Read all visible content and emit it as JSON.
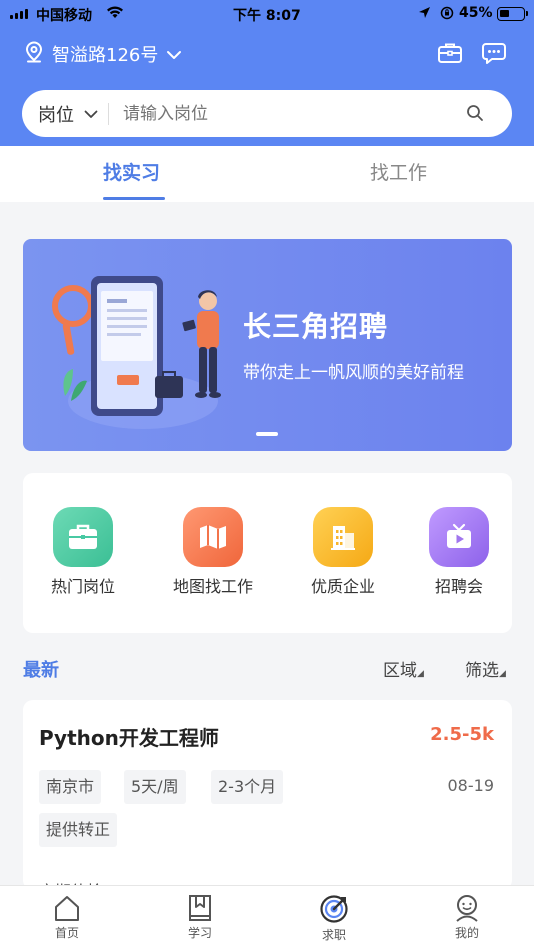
{
  "status_bar": {
    "carrier": "中国移动",
    "time": "下午 8:07",
    "battery_text": "45%",
    "battery_level": 0.45
  },
  "header": {
    "location": "智溢路126号",
    "icons": [
      "location-pin-icon",
      "chevron-down-icon",
      "briefcase-icon",
      "message-icon"
    ]
  },
  "search": {
    "category": "岗位",
    "placeholder": "请输入岗位"
  },
  "tabs": [
    {
      "label": "找实习",
      "active": true
    },
    {
      "label": "找工作",
      "active": false
    }
  ],
  "banner": {
    "title": "长三角招聘",
    "subtitle": "带你走上一帆风顺的美好前程"
  },
  "quick_links": [
    {
      "label": "热门岗位",
      "icon": "briefcase-icon",
      "color": "#48c9a3"
    },
    {
      "label": "地图找工作",
      "icon": "map-icon",
      "color": "#f3744b"
    },
    {
      "label": "优质企业",
      "icon": "building-icon",
      "color": "#f7b52c"
    },
    {
      "label": "招聘会",
      "icon": "tv-play-icon",
      "color": "#a176ee"
    }
  ],
  "list_header": {
    "latest": "最新",
    "area": "区域",
    "filter": "筛选"
  },
  "job": {
    "title": "Python开发工程师",
    "salary": "2.5-5k",
    "date": "08-19",
    "tags": [
      "南京市",
      "5天/周",
      "2-3个月",
      "提供转正"
    ],
    "more": "定期体检"
  },
  "tabbar": [
    {
      "label": "首页",
      "icon": "home-icon",
      "active": false
    },
    {
      "label": "学习",
      "icon": "bookmark-book-icon",
      "active": false
    },
    {
      "label": "求职",
      "icon": "target-icon",
      "active": true
    },
    {
      "label": "我的",
      "icon": "user-icon",
      "active": false
    }
  ],
  "colors": {
    "primary": "#5b86f3",
    "accent_blue": "#4f7de5",
    "salary": "#ef6b4a"
  }
}
